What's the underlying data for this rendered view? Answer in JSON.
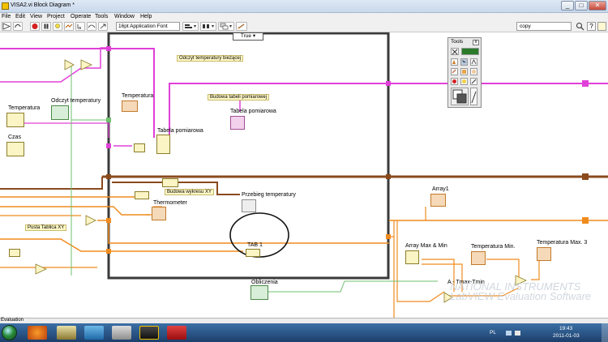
{
  "window": {
    "title": "VISA2.vi Block Diagram *",
    "controls": {
      "minimize": "_",
      "maximize": "□",
      "close": "✕"
    }
  },
  "menu": [
    "File",
    "Edit",
    "View",
    "Project",
    "Operate",
    "Tools",
    "Window",
    "Help"
  ],
  "toolbar": {
    "font": "16pt Application Font",
    "search_value": "copy",
    "help_label": "?"
  },
  "diagram": {
    "case_selector": "True ▾",
    "free_labels": {
      "odczyt": "Odczyt temperatury bieżącej",
      "budowa_tabeli": "Budowa tabeli pomiarowej",
      "budowa_wykresu": "Budowa wykresu XY",
      "pusta_tablica": "Pusta Tablica XY"
    },
    "node_labels": {
      "temperatura_in": "Temperatura",
      "temperatura_left": "Temperatura",
      "czas": "Czas",
      "odczyt_temperatury": "Odczyt temperatury",
      "tabela_pomiarowa_in": "Tabela pomiarowa",
      "tabela_pomiarowa_out": "Tabela pomiarowa",
      "thermometer": "Thermometer",
      "przebieg": "Przebieg temperatury",
      "tab1": "TAB 1",
      "array1": "Array1",
      "array_maxmin": "Array Max & Min",
      "temp_min": "Temperatura Min.",
      "temp_max": "Temperatura Max. 3",
      "obliczenia": "Obliczenia",
      "a_tmax_tmin": "A - Tmax-Tmin"
    }
  },
  "tools_palette": {
    "title": "Tools",
    "close": "x"
  },
  "status": {
    "evaluation": "Evaluation"
  },
  "watermark": {
    "line1": "NATIONAL INSTRUMENTS",
    "line2": "LabVIEW Evaluation Software"
  },
  "taskbar": {
    "language": "PL",
    "time": "19:43",
    "date": "2011-01-03"
  },
  "colors": {
    "pink_wire": "#e040d8",
    "orange_wire": "#f08b1e",
    "brown_wire": "#8a4a1c",
    "green_wire": "#6fc06f",
    "struct_border": "#3a3a3a"
  }
}
